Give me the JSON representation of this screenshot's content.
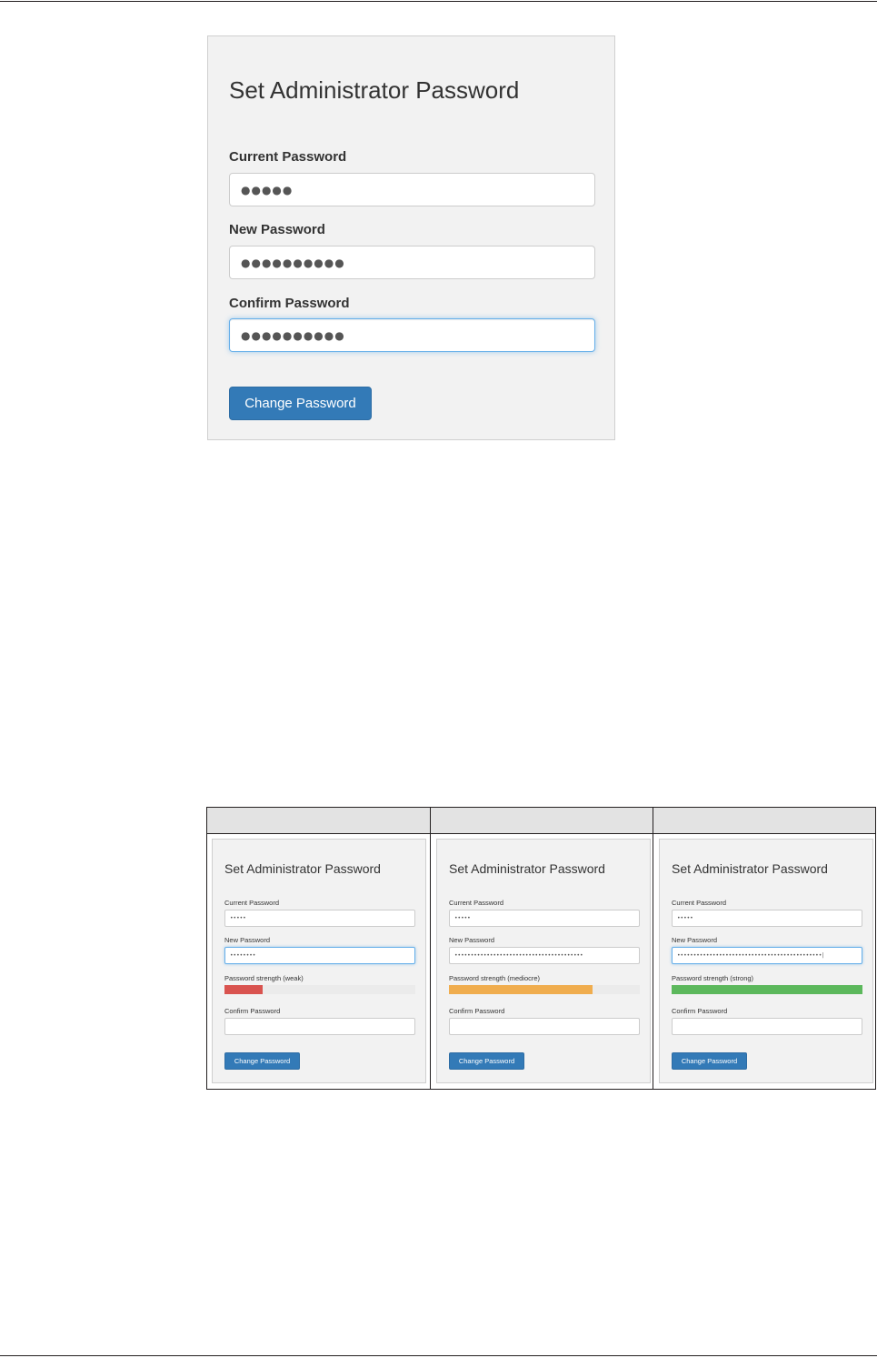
{
  "main_form": {
    "title": "Set Administrator Password",
    "current_password": {
      "label": "Current Password",
      "value": "●●●●●"
    },
    "new_password": {
      "label": "New Password",
      "value": "●●●●●●●●●●"
    },
    "confirm_password": {
      "label": "Confirm Password",
      "value": "●●●●●●●●●●"
    },
    "button": "Change Password"
  },
  "strength_examples": [
    {
      "title": "Set Administrator Password",
      "current_label": "Current Password",
      "current_value": "•••••",
      "new_label": "New Password",
      "new_value": "••••••••",
      "strength_label": "Password strength (weak)",
      "strength_fraction": 0.2,
      "strength_color": "#d9534f",
      "confirm_label": "Confirm Password",
      "confirm_value": "",
      "button": "Change Password"
    },
    {
      "title": "Set Administrator Password",
      "current_label": "Current Password",
      "current_value": "•••••",
      "new_label": "New Password",
      "new_value": "••••••••••••••••••••••••••••••••••••••••",
      "strength_label": "Password strength (mediocre)",
      "strength_fraction": 0.75,
      "strength_color": "#f0ad4e",
      "confirm_label": "Confirm Password",
      "confirm_value": "",
      "button": "Change Password"
    },
    {
      "title": "Set Administrator Password",
      "current_label": "Current Password",
      "current_value": "•••••",
      "new_label": "New Password",
      "new_value": "•••••••••••••••••••••••••••••••••••••••••••••|",
      "strength_label": "Password strength (strong)",
      "strength_fraction": 1.0,
      "strength_color": "#5cb85c",
      "confirm_label": "Confirm Password",
      "confirm_value": "",
      "button": "Change Password"
    }
  ]
}
